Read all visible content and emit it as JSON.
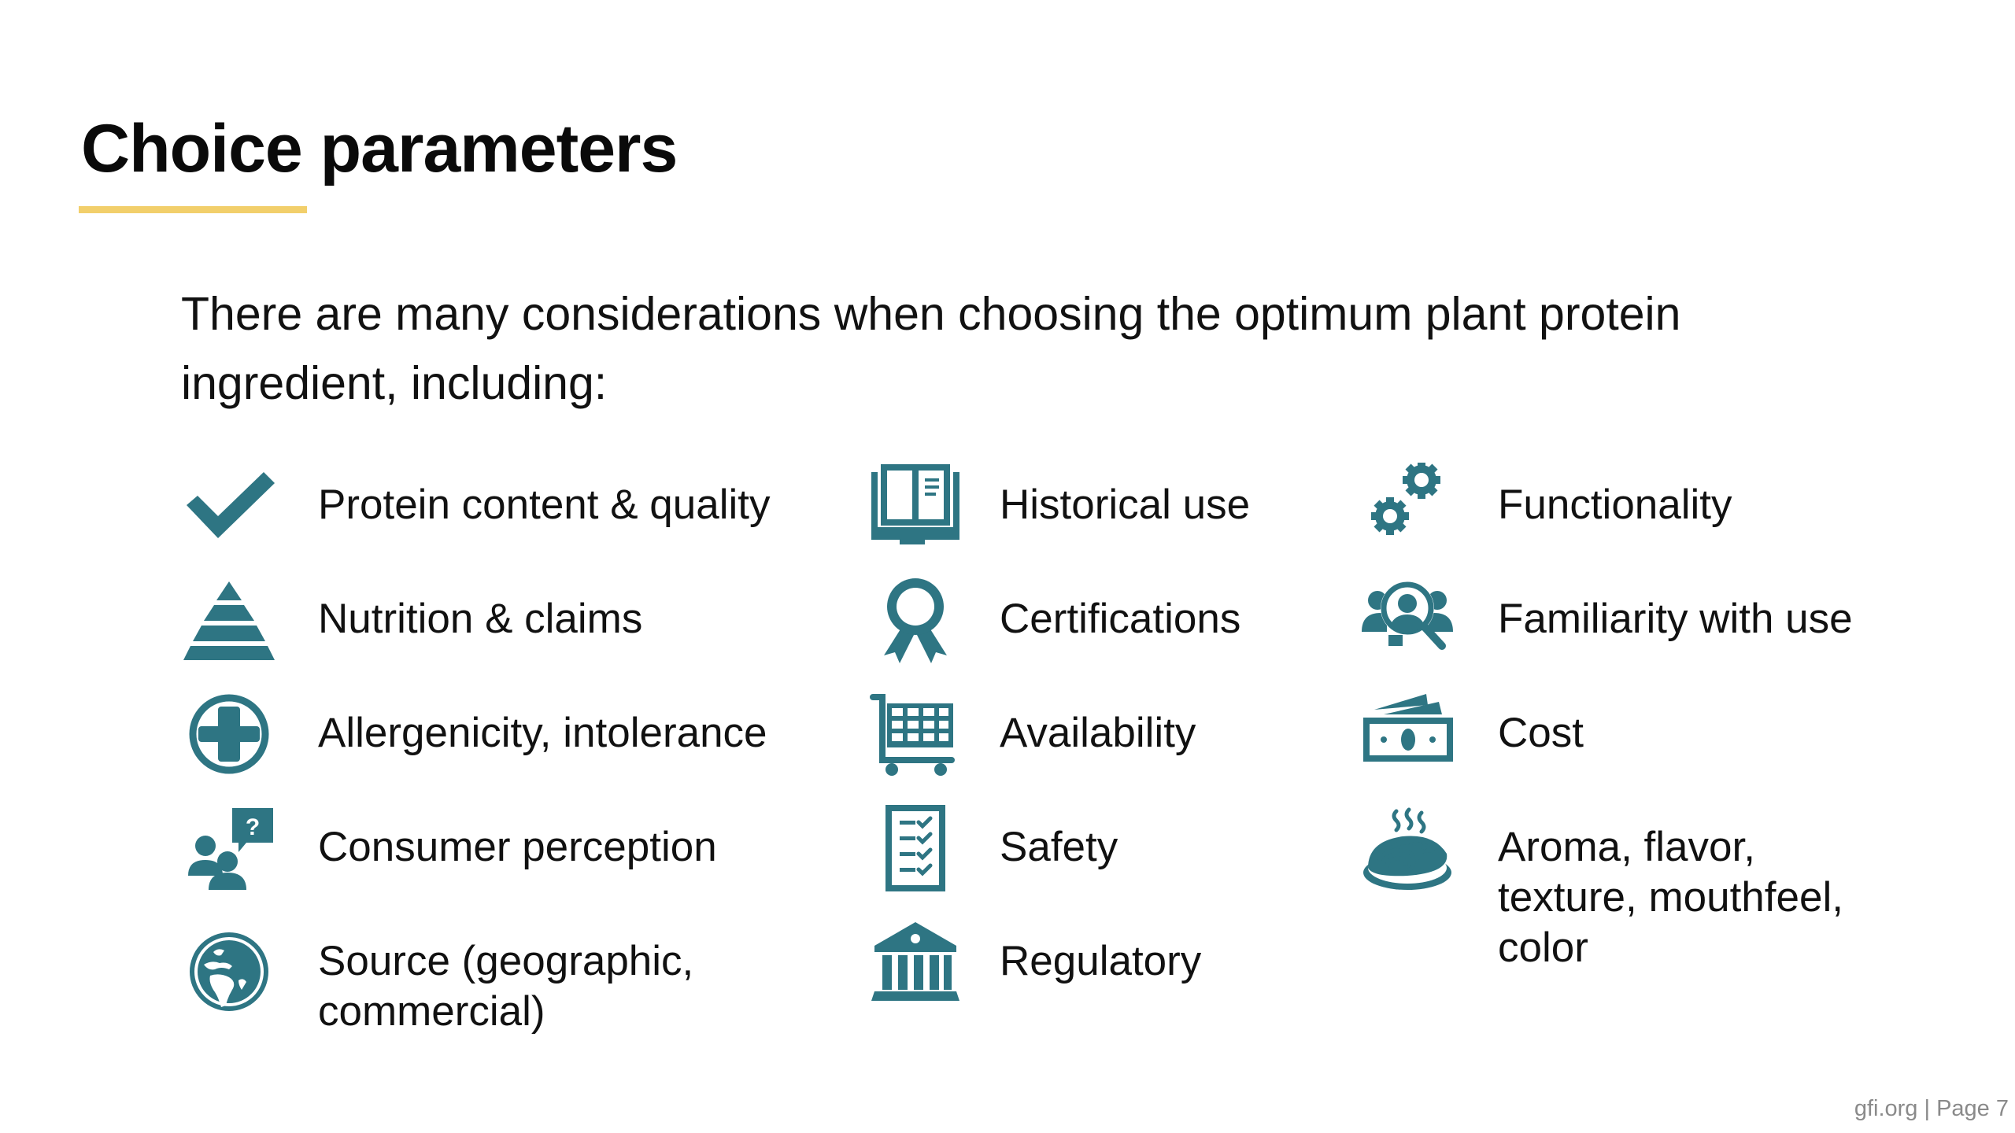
{
  "slide": {
    "title": "Choice parameters",
    "intro": "There are many considerations when choosing the optimum plant protein ingredient, including:",
    "accent_color": "#F2CF6B",
    "icon_color": "#2E7583"
  },
  "columns": [
    {
      "items": [
        {
          "icon": "checkmark-icon",
          "label": "Protein content & quality"
        },
        {
          "icon": "pyramid-icon",
          "label": "Nutrition & claims"
        },
        {
          "icon": "medical-cross-icon",
          "label": "Allergenicity, intolerance"
        },
        {
          "icon": "people-question-icon",
          "label": "Consumer perception"
        },
        {
          "icon": "globe-icon",
          "label": "Source (geographic,\ncommercial)"
        }
      ]
    },
    {
      "items": [
        {
          "icon": "open-book-icon",
          "label": "Historical use"
        },
        {
          "icon": "award-ribbon-icon",
          "label": "Certifications"
        },
        {
          "icon": "shopping-cart-icon",
          "label": "Availability"
        },
        {
          "icon": "checklist-icon",
          "label": "Safety"
        },
        {
          "icon": "government-building-icon",
          "label": "Regulatory"
        }
      ]
    },
    {
      "items": [
        {
          "icon": "gears-icon",
          "label": "Functionality"
        },
        {
          "icon": "people-search-icon",
          "label": "Familiarity with use"
        },
        {
          "icon": "money-bills-icon",
          "label": "Cost"
        },
        {
          "icon": "steaming-food-icon",
          "label": "Aroma, flavor,\ntexture, mouthfeel,\ncolor"
        }
      ]
    }
  ],
  "footer": {
    "text": "gfi.org | Page 7"
  }
}
